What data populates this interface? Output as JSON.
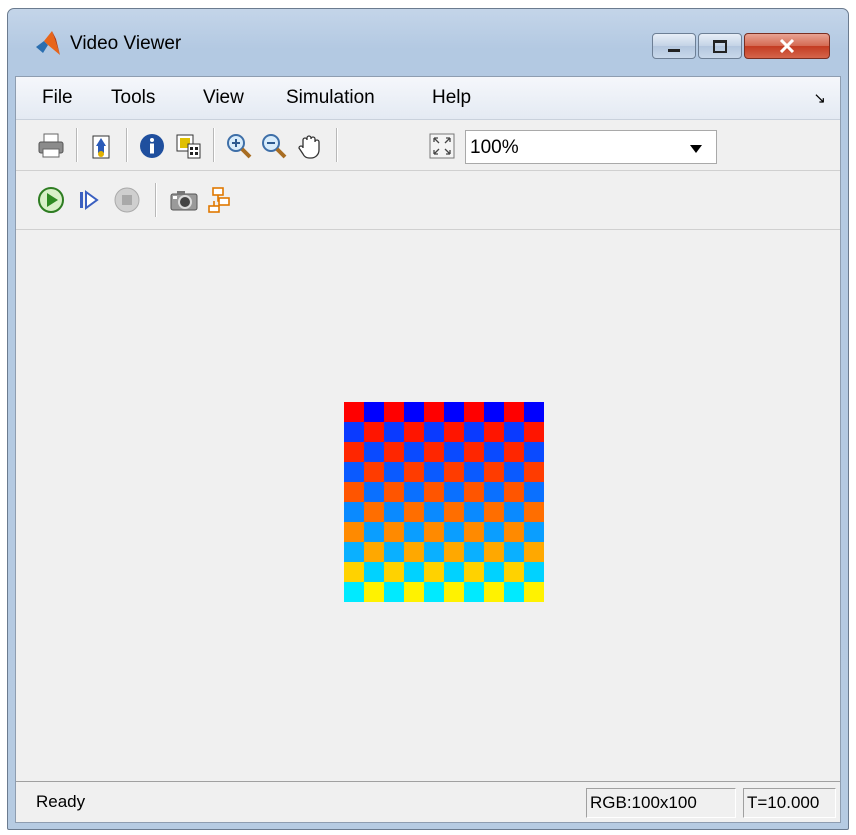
{
  "window": {
    "title": "Video Viewer"
  },
  "menu": {
    "items": [
      "File",
      "Tools",
      "View",
      "Simulation",
      "Help"
    ]
  },
  "toolbar": {
    "zoom_value": "100%",
    "icons": [
      "print-icon",
      "parameters-icon",
      "info-icon",
      "colormap-icon",
      "zoom-in-icon",
      "zoom-out-icon",
      "pan-hand-icon",
      "fit-to-view-icon"
    ]
  },
  "sim_toolbar": {
    "icons": [
      "run-icon",
      "step-forward-icon",
      "stop-icon",
      "snapshot-icon",
      "highlight-block-icon"
    ]
  },
  "video": {
    "grid_rows": 10,
    "grid_cols": 10,
    "row_colors_a": [
      "#ff0000",
      "#0a3aff",
      "#ff2600",
      "#0a5aff",
      "#ff5500",
      "#0a8aff",
      "#ff8a00",
      "#0ab0ff",
      "#ffd200",
      "#00eaff"
    ],
    "row_colors_b": [
      "#0000ff",
      "#ff1500",
      "#0a4aff",
      "#ff3c00",
      "#0a70ff",
      "#ff6e00",
      "#0a9eff",
      "#ffa800",
      "#00d2ff",
      "#fff200"
    ]
  },
  "status": {
    "text": "Ready",
    "rgb": "RGB:100x100",
    "time": "T=10.000"
  },
  "colors": {
    "title_bar": "#b9cde4",
    "client_bg": "#f0f0f0",
    "close_button": "#c94a30"
  }
}
